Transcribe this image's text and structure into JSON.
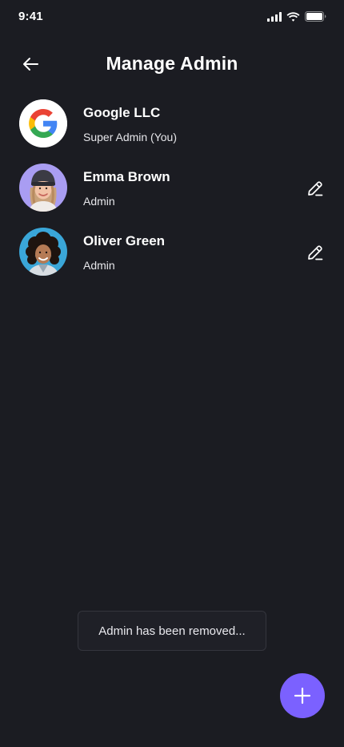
{
  "status_bar": {
    "time": "9:41"
  },
  "header": {
    "title": "Manage Admin",
    "back_icon": "arrow-left-icon"
  },
  "admins": [
    {
      "name": "Google LLC",
      "role": "Super Admin (You)",
      "avatar": "google-logo",
      "editable": false
    },
    {
      "name": "Emma Brown",
      "role": "Admin",
      "avatar": "emma-photo",
      "editable": true
    },
    {
      "name": "Oliver Green",
      "role": "Admin",
      "avatar": "oliver-photo",
      "editable": true
    }
  ],
  "toast": {
    "message": "Admin has been removed..."
  },
  "fab": {
    "icon": "plus-icon"
  },
  "colors": {
    "background": "#1b1c22",
    "accent": "#7b61ff",
    "toast_border": "#34353d"
  }
}
